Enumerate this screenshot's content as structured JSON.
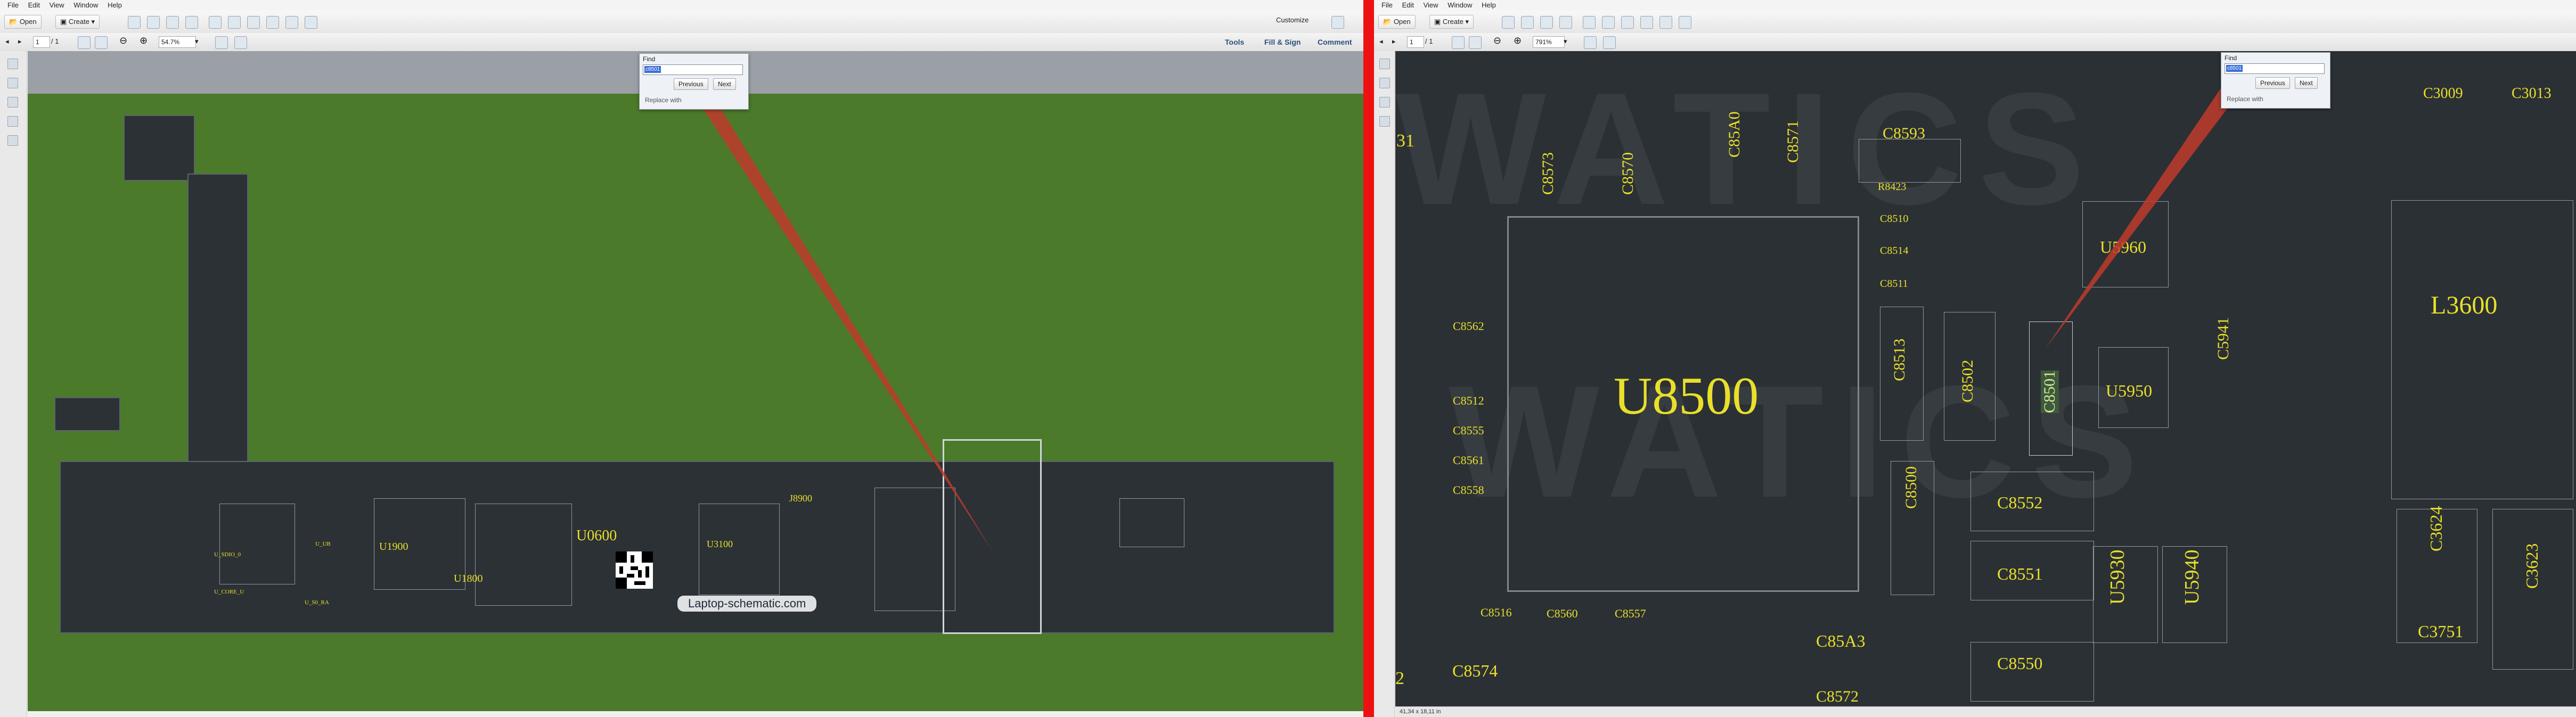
{
  "menu": [
    "File",
    "Edit",
    "View",
    "Window",
    "Help"
  ],
  "toolbar": {
    "open_label": "Open",
    "create_label": "Create",
    "customize_label": "Customize"
  },
  "nav": {
    "page_current": "1",
    "page_total": "/ 1",
    "zoom_left": "54.7%",
    "zoom_right": "791%"
  },
  "right_links": {
    "tools": "Tools",
    "fill_sign": "Fill & Sign",
    "comment": "Comment"
  },
  "find": {
    "title": "Find",
    "query": "c8501",
    "previous": "Previous",
    "next": "Next",
    "replace": "Replace with"
  },
  "watermark_url": "Laptop-schematic.com",
  "status_size": "41,34 x 18,11 in",
  "board_left_labels": {
    "u0600": "U0600",
    "u1900": "U1900",
    "u1800": "U1800",
    "u3100": "U3100",
    "j8900": "J8900",
    "l1": "U_SDIO_0",
    "l2": "U_UB",
    "l3": "U_CORE_U",
    "l4": "U_S0_RA"
  },
  "board_right_labels": {
    "u8500": "U8500",
    "u5960": "U5960",
    "u5950": "U5950",
    "u5930": "U5930",
    "u5940": "U5940",
    "l3600": "L3600",
    "c3009": "C3009",
    "c3013": "C3013",
    "c8593": "C8593",
    "c8573": "C8573",
    "c8570": "C8570",
    "c85a0": "C85A0",
    "c8571": "C8571",
    "c8513": "C8513",
    "c8502": "C8502",
    "c8501": "C8501",
    "c8500": "C8500",
    "c8552": "C8552",
    "c8551": "C8551",
    "c8550": "C8550",
    "c85a3": "C85A3",
    "c8574": "C8574",
    "c8572": "C8572",
    "c5941": "C5941",
    "c3624": "C3624",
    "c3623": "C3623",
    "c3751": "C3751",
    "c8562": "C8562",
    "c8512": "C8512",
    "c8555": "C8555",
    "c8561": "C8561",
    "c8558": "C8558",
    "c8516": "C8516",
    "c8560": "C8560",
    "c8557": "C8557",
    "c8510": "C8510",
    "c8514": "C8514",
    "c8511": "C8511",
    "r8423": "R8423",
    "edge_31": "31",
    "edge_2": "2"
  },
  "colors": {
    "board_green": "#4b7a2a",
    "board_dark": "#2c3136",
    "label_yellow": "#e8e02a",
    "divider": "#ee1111",
    "pointer": "#c0392b"
  }
}
